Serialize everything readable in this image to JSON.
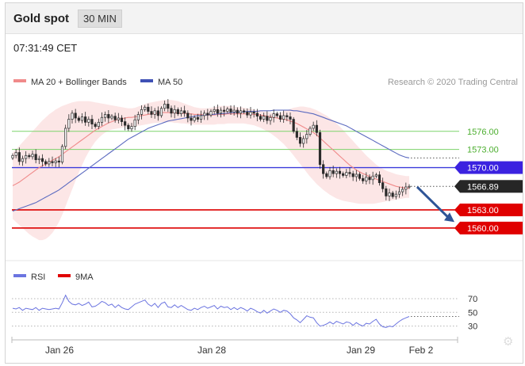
{
  "header": {
    "title": "Gold spot",
    "interval": "30 MIN",
    "time": "07:31:49 CET"
  },
  "legend": {
    "bollinger": {
      "label": "MA 20 + Bollinger Bands",
      "color": "#f08a8a"
    },
    "ma50": {
      "label": "MA 50",
      "color": "#3f51b5"
    },
    "credit": "Research © 2020 Trading Central"
  },
  "rsi_legend": {
    "rsi": {
      "label": "RSI",
      "color": "#6b74e0"
    },
    "ma9": {
      "label": "9MA",
      "color": "#e00000"
    }
  },
  "chart_data": [
    {
      "type": "candlestick",
      "title": "Gold spot",
      "ylim": [
        1555,
        1582
      ],
      "x_tick_labels": [
        "Jan 26",
        "Jan 28",
        "Jan 29",
        "Feb 2"
      ],
      "close_series": [
        1572.0,
        1572.5,
        1571.0,
        1571.5,
        1572.0,
        1571.8,
        1572.2,
        1571.3,
        1571.5,
        1571.0,
        1570.6,
        1571.0,
        1570.8,
        1571.1,
        1570.9,
        1573.5,
        1576.5,
        1578.0,
        1579.0,
        1578.2,
        1577.8,
        1578.4,
        1577.5,
        1578.0,
        1577.2,
        1576.8,
        1577.5,
        1578.3,
        1578.8,
        1578.2,
        1578.5,
        1577.9,
        1578.2,
        1577.6,
        1577.0,
        1576.4,
        1576.8,
        1577.9,
        1578.8,
        1579.6,
        1580.0,
        1579.3,
        1578.8,
        1579.4,
        1578.6,
        1579.8,
        1580.5,
        1579.8,
        1579.0,
        1579.6,
        1578.9,
        1579.4,
        1579.0,
        1578.2,
        1577.8,
        1578.3,
        1578.0,
        1578.6,
        1579.0,
        1578.7,
        1579.3,
        1579.6,
        1579.0,
        1579.5,
        1579.3,
        1579.7,
        1579.2,
        1579.5,
        1579.0,
        1579.4,
        1579.2,
        1578.7,
        1579.2,
        1579.0,
        1578.5,
        1578.0,
        1578.5,
        1577.8,
        1578.3,
        1578.9,
        1578.6,
        1578.0,
        1578.6,
        1578.4,
        1578.0,
        1576.0,
        1575.0,
        1574.0,
        1574.8,
        1575.5,
        1576.5,
        1577.0,
        1575.8,
        1570.5,
        1569.0,
        1568.5,
        1569.5,
        1569.0,
        1569.4,
        1569.0,
        1568.7,
        1569.2,
        1569.0,
        1568.5,
        1568.9,
        1568.2,
        1567.8,
        1568.4,
        1568.0,
        1568.6,
        1568.8,
        1567.5,
        1566.5,
        1565.3,
        1565.8,
        1565.2,
        1565.6,
        1566.0,
        1566.4,
        1566.8,
        1566.9
      ],
      "ma20": [
        1567.0,
        1567.3,
        1567.6,
        1568.0,
        1568.4,
        1568.8,
        1569.2,
        1569.6,
        1570.0,
        1570.3,
        1570.6,
        1570.9,
        1571.2,
        1571.5,
        1571.8,
        1572.2,
        1572.6,
        1573.0,
        1573.4,
        1573.8,
        1574.2,
        1574.6,
        1575.0,
        1575.4,
        1575.8,
        1576.2,
        1576.5,
        1576.8,
        1577.1,
        1577.4,
        1577.6,
        1577.8,
        1578.0,
        1578.1,
        1578.2,
        1578.3,
        1578.3,
        1578.4,
        1578.5,
        1578.6,
        1578.7,
        1578.8,
        1578.9,
        1579.0,
        1579.0,
        1579.1,
        1579.1,
        1579.1,
        1579.1,
        1579.1,
        1579.0,
        1579.0,
        1579.0,
        1578.9,
        1578.9,
        1578.8,
        1578.8,
        1578.8,
        1578.7,
        1578.7,
        1578.7,
        1578.7,
        1578.8,
        1578.8,
        1578.8,
        1578.9,
        1578.9,
        1578.9,
        1578.9,
        1578.9,
        1578.9,
        1578.9,
        1578.9,
        1578.8,
        1578.8,
        1578.7,
        1578.6,
        1578.5,
        1578.4,
        1578.3,
        1578.2,
        1578.1,
        1578.0,
        1577.9,
        1577.7,
        1577.5,
        1577.3,
        1577.0,
        1576.7,
        1576.4,
        1576.1,
        1575.8,
        1575.4,
        1574.9,
        1574.4,
        1573.9,
        1573.4,
        1572.9,
        1572.4,
        1571.9,
        1571.4,
        1570.9,
        1570.4,
        1570.0,
        1569.6,
        1569.3,
        1569.0,
        1568.8,
        1568.5,
        1568.3,
        1568.1,
        1567.9,
        1567.7,
        1567.5,
        1567.3,
        1567.1,
        1566.9,
        1566.8,
        1566.7,
        1566.6,
        1566.6
      ],
      "bb_upper": [
        1572.5,
        1573.0,
        1573.6,
        1574.2,
        1574.8,
        1575.4,
        1576.0,
        1576.6,
        1577.2,
        1577.8,
        1578.3,
        1578.8,
        1579.2,
        1579.6,
        1579.9,
        1580.2,
        1580.4,
        1580.6,
        1580.8,
        1580.9,
        1581.0,
        1581.0,
        1581.0,
        1581.0,
        1580.9,
        1580.8,
        1580.7,
        1580.6,
        1580.5,
        1580.4,
        1580.3,
        1580.2,
        1580.1,
        1580.0,
        1579.9,
        1579.8,
        1579.8,
        1579.9,
        1580.1,
        1580.3,
        1580.5,
        1580.7,
        1580.8,
        1580.9,
        1581.0,
        1581.1,
        1581.2,
        1581.2,
        1581.2,
        1581.1,
        1581.0,
        1580.8,
        1580.6,
        1580.4,
        1580.2,
        1580.0,
        1579.9,
        1579.8,
        1579.8,
        1579.8,
        1579.9,
        1580.0,
        1580.1,
        1580.2,
        1580.2,
        1580.2,
        1580.2,
        1580.1,
        1580.0,
        1580.0,
        1579.9,
        1579.8,
        1579.7,
        1579.6,
        1579.5,
        1579.4,
        1579.3,
        1579.2,
        1579.1,
        1579.0,
        1579.0,
        1579.1,
        1579.3,
        1579.5,
        1579.7,
        1579.9,
        1580.0,
        1580.1,
        1580.1,
        1580.0,
        1579.9,
        1579.7,
        1579.5,
        1579.2,
        1578.9,
        1578.6,
        1578.2,
        1577.8,
        1577.3,
        1576.8,
        1576.2,
        1575.6,
        1575.0,
        1574.4,
        1573.8,
        1573.2,
        1572.6,
        1572.0,
        1571.5,
        1571.0,
        1570.5,
        1570.1,
        1569.8,
        1569.5,
        1569.3,
        1569.1,
        1568.9,
        1568.8,
        1568.7,
        1568.6,
        1568.6
      ],
      "bb_lower": [
        1561.5,
        1561.0,
        1560.5,
        1560.0,
        1559.5,
        1559.0,
        1558.6,
        1558.3,
        1558.0,
        1558.0,
        1558.2,
        1558.6,
        1559.2,
        1560.0,
        1561.0,
        1562.2,
        1563.6,
        1565.0,
        1566.4,
        1567.8,
        1569.2,
        1570.4,
        1571.6,
        1572.6,
        1573.5,
        1574.3,
        1574.9,
        1575.4,
        1575.8,
        1576.1,
        1576.3,
        1576.4,
        1576.5,
        1576.6,
        1576.7,
        1576.8,
        1576.8,
        1576.8,
        1576.9,
        1577.0,
        1577.1,
        1577.2,
        1577.3,
        1577.4,
        1577.4,
        1577.5,
        1577.5,
        1577.5,
        1577.5,
        1577.4,
        1577.4,
        1577.3,
        1577.3,
        1577.2,
        1577.2,
        1577.1,
        1577.1,
        1577.1,
        1577.1,
        1577.1,
        1577.1,
        1577.1,
        1577.2,
        1577.2,
        1577.2,
        1577.3,
        1577.3,
        1577.3,
        1577.3,
        1577.3,
        1577.3,
        1577.2,
        1577.1,
        1577.0,
        1576.8,
        1576.6,
        1576.3,
        1576.0,
        1575.7,
        1575.3,
        1574.9,
        1574.4,
        1573.9,
        1573.3,
        1572.7,
        1572.0,
        1571.3,
        1570.6,
        1569.9,
        1569.2,
        1568.5,
        1567.9,
        1567.3,
        1566.8,
        1566.3,
        1565.9,
        1565.5,
        1565.2,
        1564.9,
        1564.7,
        1564.5,
        1564.4,
        1564.3,
        1564.2,
        1564.1,
        1564.0,
        1564.0,
        1564.0,
        1564.0,
        1564.0,
        1564.1,
        1564.2,
        1564.3,
        1564.4,
        1564.5,
        1564.6,
        1564.7,
        1564.8,
        1564.9,
        1565.0,
        1565.0
      ],
      "ma50": [
        1562.8,
        1563.0,
        1563.2,
        1563.4,
        1563.6,
        1563.8,
        1564.0,
        1564.2,
        1564.5,
        1564.8,
        1565.1,
        1565.4,
        1565.7,
        1566.0,
        1566.3,
        1566.7,
        1567.1,
        1567.5,
        1567.9,
        1568.3,
        1568.7,
        1569.1,
        1569.5,
        1569.9,
        1570.3,
        1570.7,
        1571.1,
        1571.5,
        1571.9,
        1572.3,
        1572.7,
        1573.1,
        1573.5,
        1573.9,
        1574.3,
        1574.7,
        1575.0,
        1575.3,
        1575.6,
        1575.9,
        1576.2,
        1576.5,
        1576.7,
        1576.9,
        1577.1,
        1577.3,
        1577.5,
        1577.7,
        1577.8,
        1577.9,
        1578.0,
        1578.1,
        1578.2,
        1578.3,
        1578.4,
        1578.5,
        1578.6,
        1578.6,
        1578.7,
        1578.7,
        1578.8,
        1578.8,
        1578.9,
        1578.9,
        1579.0,
        1579.0,
        1579.1,
        1579.1,
        1579.2,
        1579.2,
        1579.2,
        1579.3,
        1579.3,
        1579.3,
        1579.3,
        1579.4,
        1579.4,
        1579.4,
        1579.4,
        1579.5,
        1579.5,
        1579.5,
        1579.5,
        1579.5,
        1579.5,
        1579.4,
        1579.4,
        1579.3,
        1579.2,
        1579.1,
        1579.0,
        1578.9,
        1578.7,
        1578.5,
        1578.3,
        1578.1,
        1577.9,
        1577.7,
        1577.5,
        1577.3,
        1577.1,
        1576.9,
        1576.6,
        1576.3,
        1576.0,
        1575.7,
        1575.4,
        1575.1,
        1574.8,
        1574.5,
        1574.2,
        1573.9,
        1573.6,
        1573.3,
        1573.0,
        1572.7,
        1572.4,
        1572.1,
        1571.9,
        1571.7,
        1571.6
      ],
      "levels": [
        {
          "label": "1576.00",
          "value": 1576.0,
          "kind": "resistance",
          "color": "#7cd36a"
        },
        {
          "label": "1573.00",
          "value": 1573.0,
          "kind": "resistance",
          "color": "#7cd36a"
        },
        {
          "label": "1570.00",
          "value": 1570.0,
          "kind": "pivot",
          "color": "#3b3bdb",
          "badge_color": "#3b22e0"
        },
        {
          "label": "1566.89",
          "value": 1566.89,
          "kind": "last",
          "color": "#333333",
          "badge_color": "#262626"
        },
        {
          "label": "1563.00",
          "value": 1563.0,
          "kind": "support",
          "color": "#dd0000",
          "badge_color": "#e00000"
        },
        {
          "label": "1560.00",
          "value": 1560.0,
          "kind": "support",
          "color": "#dd0000",
          "badge_color": "#e00000"
        }
      ],
      "forecast_arrow": {
        "from": 1566.8,
        "to": 1561.0,
        "color": "#2f5597"
      }
    },
    {
      "type": "line",
      "title": "RSI",
      "ylim": [
        18,
        85
      ],
      "y_tick_labels": [
        "70",
        "50",
        "30"
      ],
      "y_ticks": [
        70,
        50,
        30
      ],
      "rsi": [
        56,
        55,
        57,
        53,
        56,
        55,
        54,
        57,
        53,
        56,
        55,
        54,
        55,
        56,
        55,
        64,
        75,
        66,
        62,
        61,
        63,
        60,
        62,
        65,
        58,
        59,
        62,
        66,
        64,
        60,
        62,
        57,
        61,
        57,
        55,
        54,
        58,
        62,
        64,
        66,
        68,
        62,
        59,
        63,
        57,
        63,
        65,
        58,
        57,
        61,
        57,
        60,
        57,
        54,
        53,
        56,
        54,
        57,
        59,
        56,
        58,
        60,
        55,
        59,
        57,
        58,
        54,
        57,
        54,
        57,
        55,
        52,
        56,
        54,
        51,
        49,
        53,
        49,
        52,
        55,
        53,
        50,
        53,
        52,
        48,
        42,
        39,
        35,
        40,
        45,
        43,
        42,
        35,
        30,
        31,
        33,
        36,
        33,
        37,
        35,
        33,
        36,
        35,
        31,
        35,
        32,
        30,
        34,
        33,
        37,
        40,
        33,
        29,
        28,
        30,
        29,
        33,
        37,
        40,
        42,
        44
      ],
      "overbought": 70,
      "mid": 50,
      "oversold": 30
    }
  ]
}
